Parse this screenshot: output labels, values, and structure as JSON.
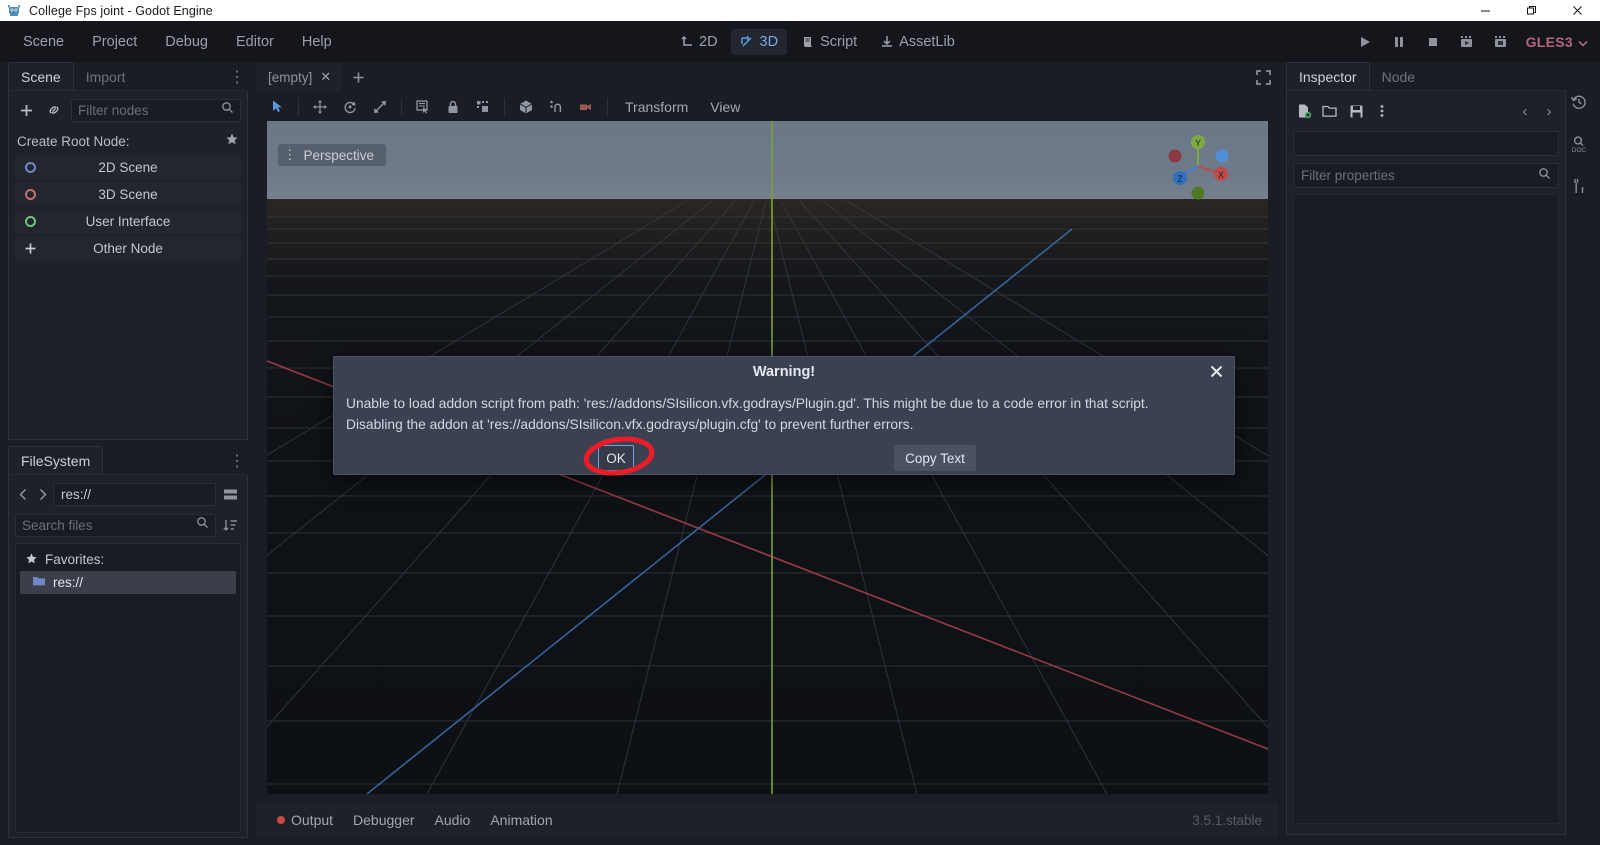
{
  "window": {
    "title": "College Fps joint - Godot Engine",
    "app_icon": "godot-robot-icon",
    "minimize_label": "—",
    "maximize_label": "❐",
    "close_label": "✕"
  },
  "menubar": {
    "items": [
      {
        "label": "Scene",
        "name": "menu-scene"
      },
      {
        "label": "Project",
        "name": "menu-project"
      },
      {
        "label": "Debug",
        "name": "menu-debug"
      },
      {
        "label": "Editor",
        "name": "menu-editor"
      },
      {
        "label": "Help",
        "name": "menu-help"
      }
    ],
    "modes": [
      {
        "label": "2D",
        "icon": "2d-icon",
        "active": false
      },
      {
        "label": "3D",
        "icon": "3d-icon",
        "active": true
      },
      {
        "label": "Script",
        "icon": "script-icon",
        "active": false
      },
      {
        "label": "AssetLib",
        "icon": "assetlib-icon",
        "active": false
      }
    ],
    "playback": [
      {
        "name": "play-button",
        "icon": "play-icon"
      },
      {
        "name": "pause-button",
        "icon": "pause-icon"
      },
      {
        "name": "stop-button",
        "icon": "stop-icon"
      },
      {
        "name": "play-scene-button",
        "icon": "play-scene-icon"
      },
      {
        "name": "play-custom-scene-button",
        "icon": "play-custom-icon"
      }
    ],
    "renderer": "GLES3",
    "renderer_color": "#b5657c"
  },
  "scene_dock": {
    "tabs": [
      {
        "label": "Scene",
        "active": true
      },
      {
        "label": "Import",
        "active": false
      }
    ],
    "kebab": "⋮",
    "add_icon": "plus-icon",
    "link_icon": "link-icon",
    "filter_placeholder": "Filter nodes",
    "search_icon": "search-icon",
    "create_root_label": "Create Root Node:",
    "favorite_icon": "star-icon",
    "root_options": [
      {
        "label": "2D Scene",
        "icon": "circle-icon",
        "color": "#6f87c4"
      },
      {
        "label": "3D Scene",
        "icon": "circle-icon",
        "color": "#c46f6f"
      },
      {
        "label": "User Interface",
        "icon": "circle-icon",
        "color": "#6fc47a"
      },
      {
        "label": "Other Node",
        "icon": "plus-icon",
        "color": "#c8ccd4"
      }
    ]
  },
  "filesystem_dock": {
    "tab_label": "FileSystem",
    "kebab": "⋮",
    "back_icon": "chevron-left-icon",
    "forward_icon": "chevron-right-icon",
    "path": "res://",
    "split_icon": "split-mode-icon",
    "search_placeholder": "Search files",
    "search_icon": "search-icon",
    "sort_icon": "sort-icon",
    "favorites_label": "Favorites:",
    "favorites_icon": "star-icon",
    "entries": [
      {
        "label": "res://",
        "icon": "folder-icon",
        "selected": true
      }
    ]
  },
  "viewport": {
    "scene_tabs": [
      {
        "label": "[empty]",
        "close": "✕",
        "active": true
      }
    ],
    "add_tab_icon": "plus-icon",
    "expand_icon": "fullscreen-icon",
    "toolbar": [
      {
        "name": "select-mode-tool",
        "icon": "cursor-icon",
        "selected": true
      },
      {
        "name": "move-mode-tool",
        "icon": "move-icon",
        "selected": false
      },
      {
        "name": "rotate-mode-tool",
        "icon": "rotate-icon",
        "selected": false
      },
      {
        "name": "scale-mode-tool",
        "icon": "scale-icon",
        "selected": false
      },
      {
        "name": "list-select-tool",
        "icon": "list-select-icon",
        "selected": false
      },
      {
        "name": "lock-tool",
        "icon": "lock-icon",
        "selected": false
      },
      {
        "name": "group-tool",
        "icon": "group-icon",
        "selected": false
      },
      {
        "name": "local-space-tool",
        "icon": "cube-icon",
        "selected": false
      },
      {
        "name": "snap-tool",
        "icon": "magnet-icon",
        "selected": false
      },
      {
        "name": "camera-preview-tool",
        "icon": "camera-icon",
        "selected": false
      }
    ],
    "menus": [
      {
        "label": "Transform",
        "name": "transform-menu"
      },
      {
        "label": "View",
        "name": "view-menu"
      }
    ],
    "perspective_label": "Perspective",
    "perspective_kebab": "⋮",
    "gizmo": {
      "axes": [
        {
          "label": "Y",
          "color": "#7bab3f"
        },
        {
          "label": "X",
          "color": "#c04a4a"
        },
        {
          "label": "Z",
          "color": "#3d7fcc"
        }
      ]
    },
    "grid": {
      "x_axis_color": "#a5414a",
      "y_axis_color": "#7ba331",
      "z_axis_color": "#3a6ea8",
      "grid_color": "#3a3f45"
    }
  },
  "bottom_panel": {
    "items": [
      {
        "label": "Output",
        "dot": true
      },
      {
        "label": "Debugger",
        "dot": false
      },
      {
        "label": "Audio",
        "dot": false
      },
      {
        "label": "Animation",
        "dot": false
      }
    ],
    "version": "3.5.1.stable"
  },
  "inspector": {
    "tabs": [
      {
        "label": "Inspector",
        "active": true
      },
      {
        "label": "Node",
        "active": false
      }
    ],
    "tools": [
      {
        "name": "new-resource-button",
        "icon": "new-file-icon"
      },
      {
        "name": "load-resource-button",
        "icon": "folder-open-icon"
      },
      {
        "name": "save-resource-button",
        "icon": "save-icon"
      },
      {
        "name": "resource-menu-button",
        "icon": "kebab-icon"
      }
    ],
    "history_back": "‹",
    "history_forward": "›",
    "filter_placeholder": "Filter properties",
    "search_icon": "search-icon",
    "side_tools": [
      {
        "name": "history-button",
        "icon": "history-icon"
      },
      {
        "name": "doc-search-button",
        "icon": "doc-search-icon"
      },
      {
        "name": "editor-tools-button",
        "icon": "tools-icon"
      }
    ]
  },
  "dialog": {
    "title": "Warning!",
    "close_label": "✕",
    "message_line1": "Unable to load addon script from path: 'res://addons/SIsilicon.vfx.godrays/Plugin.gd'. This might be due to a code error in that script.",
    "message_line2": "Disabling the addon at 'res://addons/SIsilicon.vfx.godrays/plugin.cfg' to prevent further errors.",
    "ok_label": "OK",
    "copy_label": "Copy Text",
    "annotation_color": "#ee1c26"
  }
}
